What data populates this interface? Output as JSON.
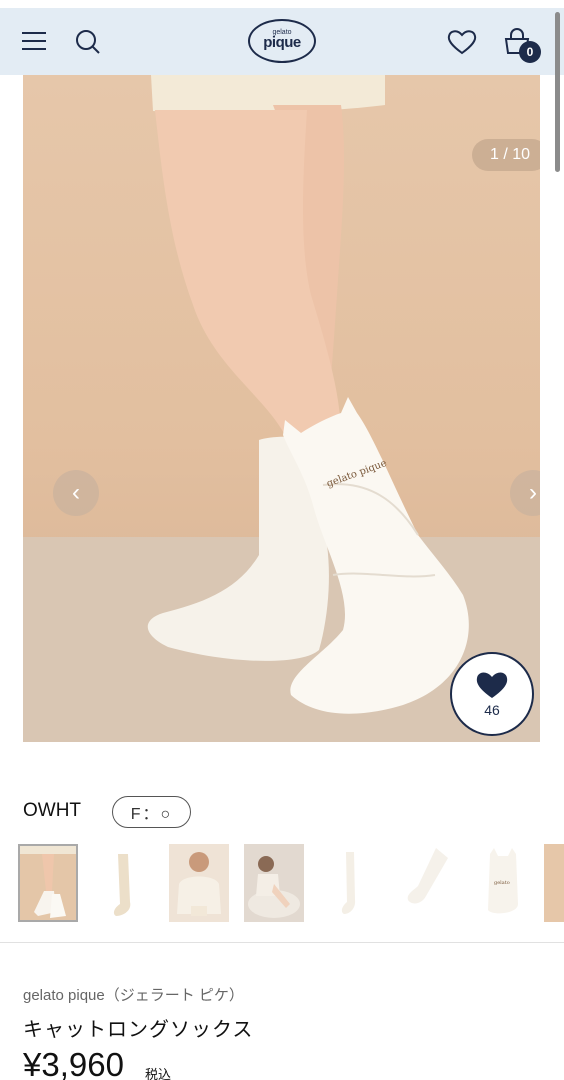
{
  "header": {
    "logo_small": "gelato",
    "logo_big": "pique",
    "cart_count": "0"
  },
  "gallery": {
    "counter": "1 / 10",
    "prev_label": "‹",
    "next_label": "›",
    "print_on_sock": "gelato pique",
    "favorite_count": "46"
  },
  "variant": {
    "color": "OWHT",
    "size": "F：○"
  },
  "product": {
    "brand": "gelato pique（ジェラート ピケ）",
    "name": "キャットロングソックス",
    "price": "¥3,960",
    "tax_label": "税込"
  },
  "colors": {
    "brand_navy": "#1d2b4a",
    "header_bg": "#e3ecf4"
  }
}
